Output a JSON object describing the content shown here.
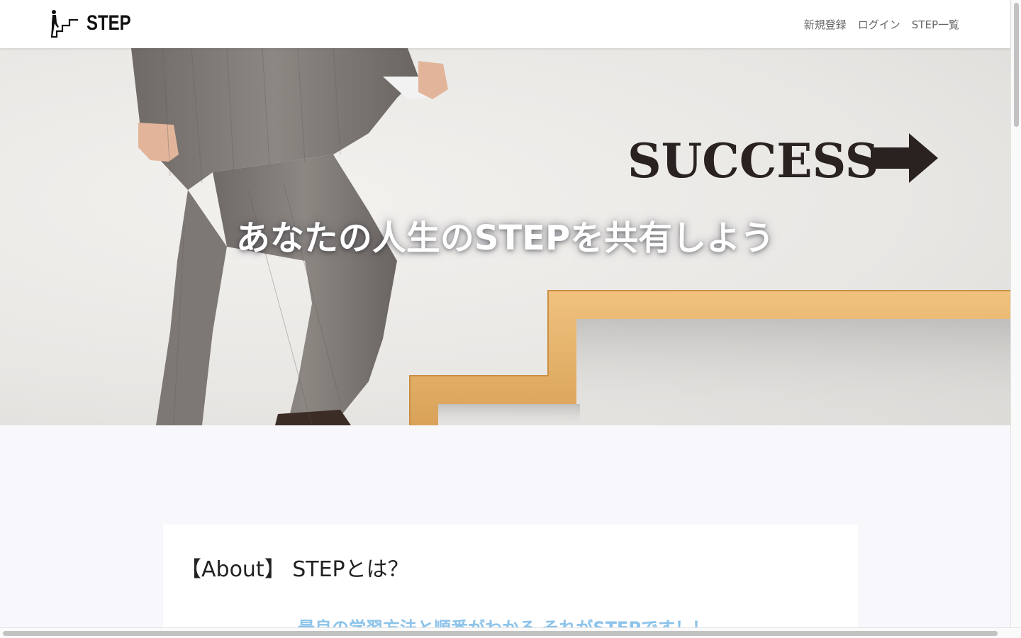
{
  "header": {
    "logo_text": "STEP",
    "nav": [
      "新規登録",
      "ログイン",
      "STEP一覧"
    ]
  },
  "hero": {
    "title": "あなたの人生のSTEPを共有しよう",
    "sign_text": "SUCCESS"
  },
  "about": {
    "title": "【About】 STEPとは？",
    "lead": "最良の学習方法と順番がわかる それがSTEPです！！"
  },
  "colors": {
    "background": "#f8f7fb",
    "lead_text": "#8cc3ea",
    "stairs": "#e6b36a"
  }
}
